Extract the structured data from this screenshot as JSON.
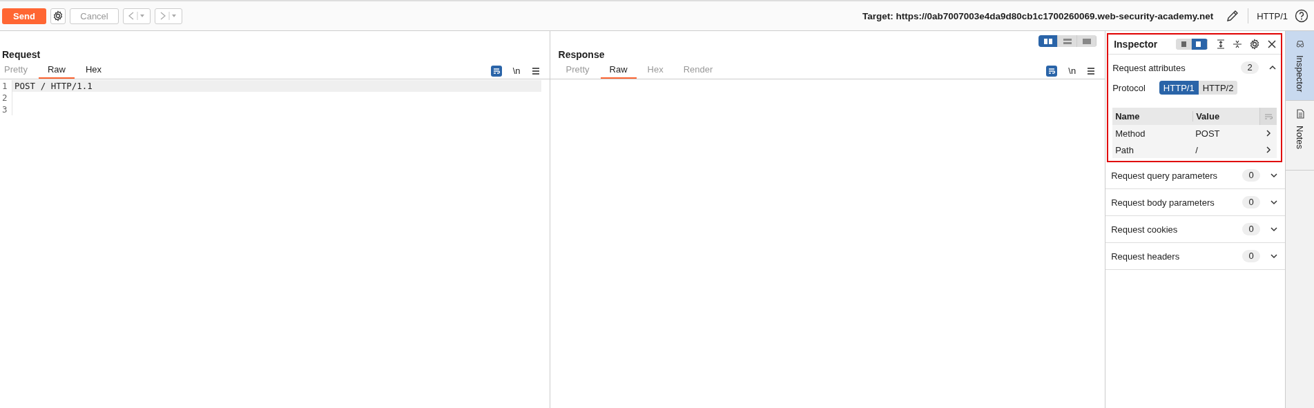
{
  "toolbar": {
    "send": "Send",
    "cancel": "Cancel",
    "target": "Target: https://0ab7007003e4da9d80cb1c1700260069.web-security-academy.net",
    "protocol": "HTTP/1"
  },
  "layout_buttons": [
    {
      "selected": true
    },
    {
      "selected": false
    },
    {
      "selected": false
    }
  ],
  "request": {
    "title": "Request",
    "tabs": [
      {
        "label": "Pretty",
        "selected": false,
        "disabled": true
      },
      {
        "label": "Raw",
        "selected": true,
        "disabled": false
      },
      {
        "label": "Hex",
        "selected": false,
        "disabled": false
      }
    ],
    "wrap_on": true,
    "newline_label": "\\n",
    "lines": [
      {
        "number": "1",
        "text": "POST / HTTP/1.1",
        "highlighted": true
      },
      {
        "number": "2",
        "highlighted": false
      },
      {
        "number": "3",
        "highlighted": false
      }
    ]
  },
  "response": {
    "title": "Response",
    "tabs": [
      {
        "label": "Pretty",
        "selected": false,
        "disabled": true
      },
      {
        "label": "Raw",
        "selected": true,
        "disabled": false
      },
      {
        "label": "Hex",
        "selected": false,
        "disabled": true
      },
      {
        "label": "Render",
        "selected": false,
        "disabled": true
      }
    ],
    "wrap_on": true,
    "newline_label": "\\n"
  },
  "inspector": {
    "title": "Inspector",
    "dock_buttons": [
      {
        "selected": false
      },
      {
        "selected": true
      }
    ],
    "sections": [
      {
        "title": "Request attributes",
        "count": "2",
        "expanded": true,
        "protocol_label": "Protocol",
        "protocol_options": [
          {
            "label": "HTTP/1",
            "selected": true
          },
          {
            "label": "HTTP/2",
            "selected": false
          }
        ],
        "columns": [
          "Name",
          "Value"
        ],
        "rows": [
          [
            "Method",
            "POST"
          ],
          [
            "Path",
            "/"
          ]
        ]
      },
      {
        "title": "Request query parameters",
        "count": "0",
        "expanded": false
      },
      {
        "title": "Request body parameters",
        "count": "0",
        "expanded": false
      },
      {
        "title": "Request cookies",
        "count": "0",
        "expanded": false
      },
      {
        "title": "Request headers",
        "count": "0",
        "expanded": false
      }
    ]
  },
  "side_tabs": [
    {
      "label": "Inspector",
      "selected": true
    },
    {
      "label": "Notes",
      "selected": false
    }
  ]
}
